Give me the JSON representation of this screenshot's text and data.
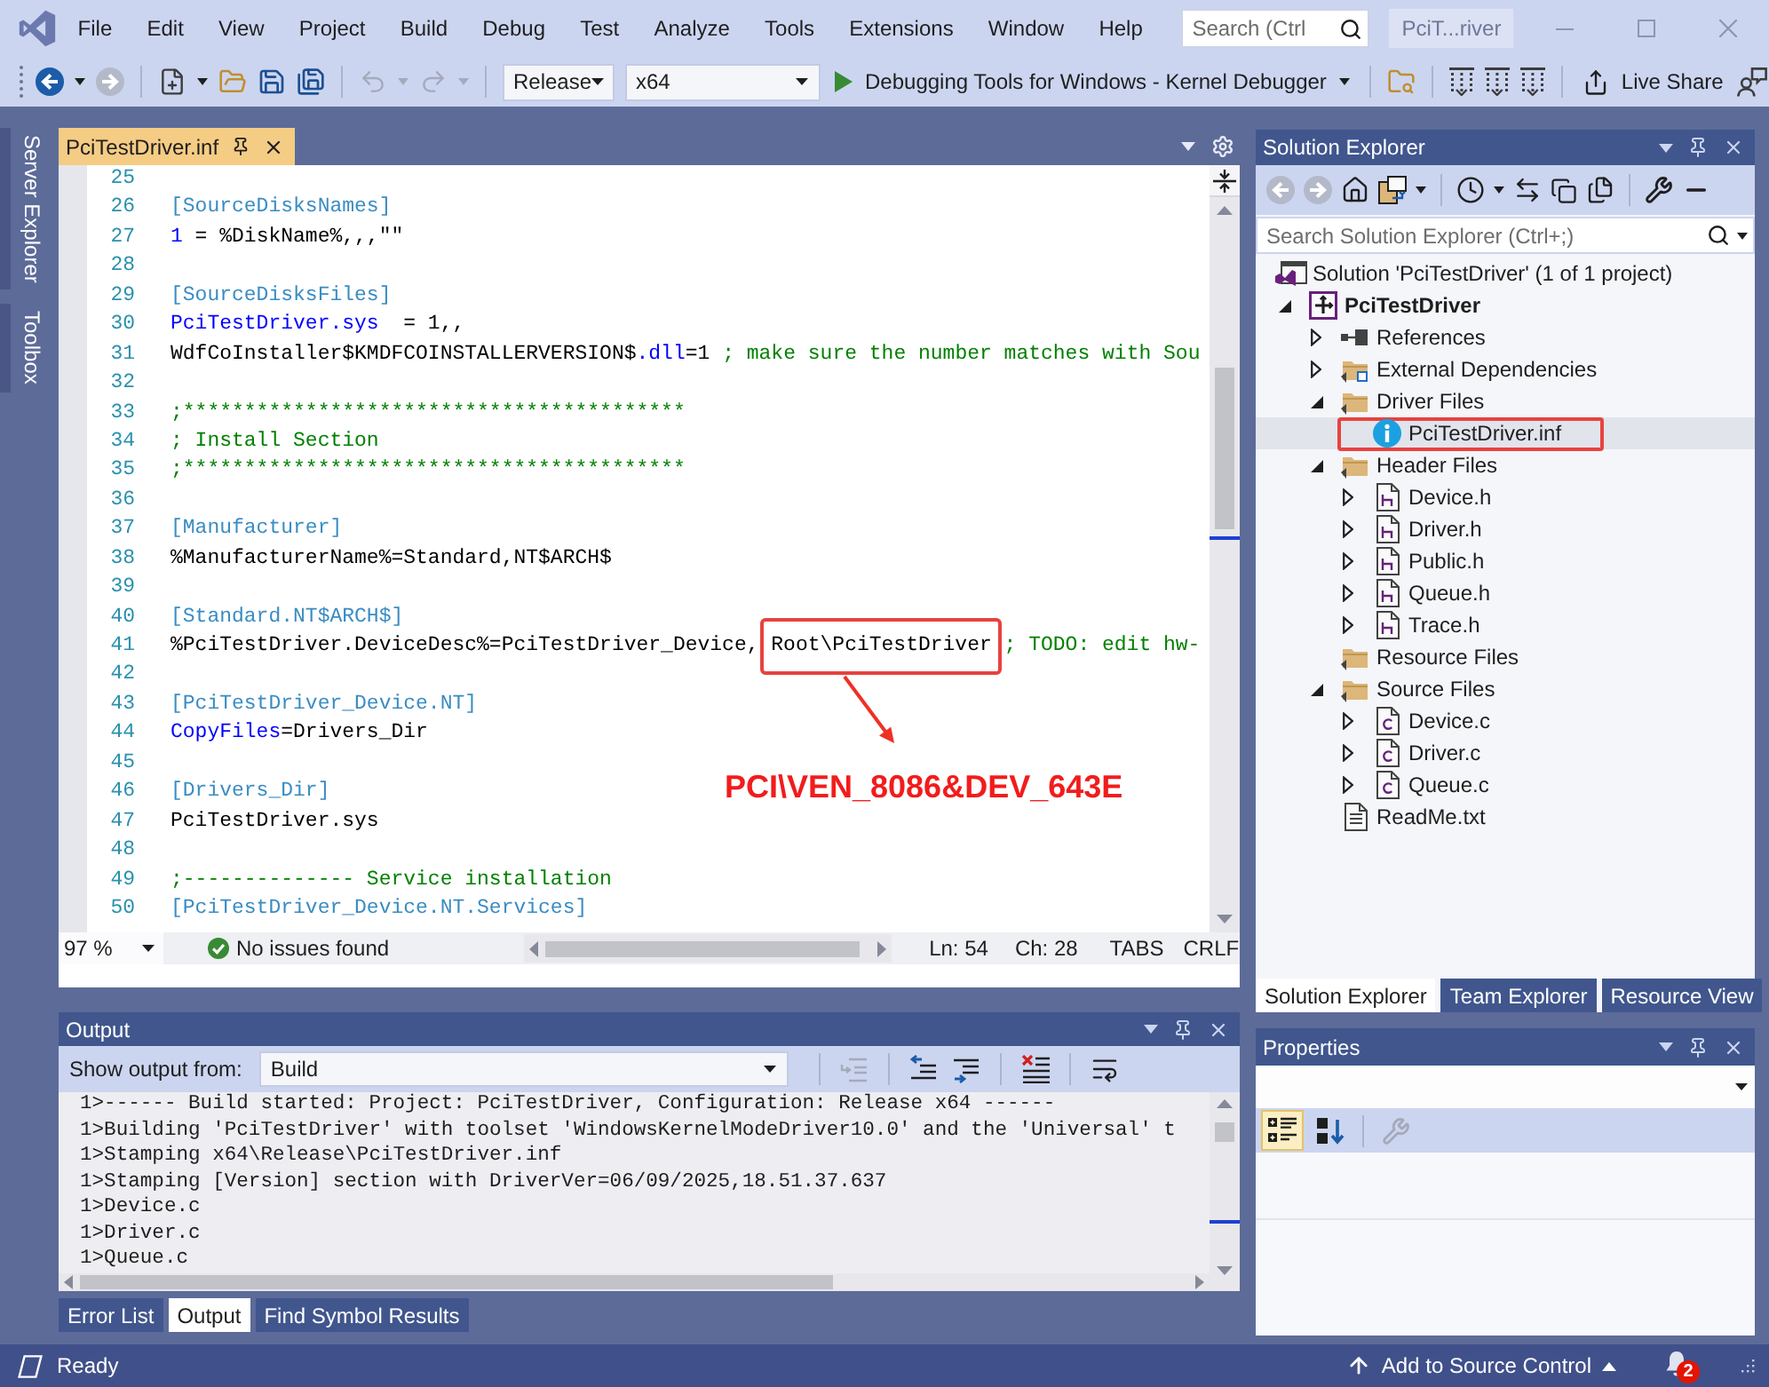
{
  "menu_bar": {
    "items": [
      "File",
      "Edit",
      "View",
      "Project",
      "Build",
      "Debug",
      "Test",
      "Analyze",
      "Tools",
      "Extensions",
      "Window",
      "Help"
    ],
    "search": {
      "placeholder": "Search (Ctrl"
    },
    "window_title": "PciT...river"
  },
  "toolbar": {
    "buttons": [
      {
        "kind": "back",
        "disabled": false
      },
      {
        "kind": "forward",
        "disabled": true
      },
      {
        "kind": "new-project",
        "disabled": false
      },
      {
        "kind": "open",
        "disabled": false
      },
      {
        "kind": "save",
        "disabled": false
      },
      {
        "kind": "save-all",
        "disabled": false
      },
      {
        "kind": "undo",
        "disabled": true
      },
      {
        "kind": "redo",
        "disabled": true
      }
    ],
    "configuration": "Release",
    "platform": "x64",
    "debug_target": "Debugging Tools for Windows - Kernel Debugger",
    "live_share": "Live Share"
  },
  "side_tabs": [
    "Server Explorer",
    "Toolbox"
  ],
  "editor": {
    "tabs": [
      {
        "label": "PciTestDriver.inf",
        "selected": true
      }
    ],
    "lines": [
      {
        "number": "25"
      },
      {
        "number": "26",
        "tokens": [
          {
            "kind": "section",
            "text": "[SourceDisksNames]"
          }
        ]
      },
      {
        "number": "27",
        "tokens": [
          {
            "kind": "keyword",
            "text": "1"
          },
          {
            "kind": "text",
            "text": " = %DiskName%,,,\"\""
          }
        ]
      },
      {
        "number": "28"
      },
      {
        "number": "29",
        "tokens": [
          {
            "kind": "section",
            "text": "[SourceDisksFiles]"
          }
        ]
      },
      {
        "number": "30",
        "tokens": [
          {
            "kind": "keyword",
            "text": "PciTestDriver.sys"
          },
          {
            "kind": "text",
            "text": "  = 1,,"
          }
        ]
      },
      {
        "number": "31",
        "tokens": [
          {
            "kind": "text",
            "text": "WdfCoInstaller$KMDFCOINSTALLERVERSION$"
          },
          {
            "kind": "keyword",
            "text": ".dll"
          },
          {
            "kind": "text",
            "text": "=1 "
          },
          {
            "kind": "comment",
            "text": "; make sure the number matches with Sou"
          }
        ]
      },
      {
        "number": "32"
      },
      {
        "number": "33",
        "tokens": [
          {
            "kind": "comment",
            "text": ";*****************************************"
          }
        ]
      },
      {
        "number": "34",
        "tokens": [
          {
            "kind": "comment",
            "text": "; Install Section"
          }
        ]
      },
      {
        "number": "35",
        "tokens": [
          {
            "kind": "comment",
            "text": ";*****************************************"
          }
        ]
      },
      {
        "number": "36"
      },
      {
        "number": "37",
        "tokens": [
          {
            "kind": "section",
            "text": "[Manufacturer]"
          }
        ]
      },
      {
        "number": "38",
        "tokens": [
          {
            "kind": "text",
            "text": "%ManufacturerName%=Standard,NT$ARCH$"
          }
        ]
      },
      {
        "number": "39"
      },
      {
        "number": "40",
        "tokens": [
          {
            "kind": "section",
            "text": "[Standard.NT$ARCH$]"
          }
        ]
      },
      {
        "number": "41",
        "tokens": [
          {
            "kind": "text",
            "text": "%PciTestDriver.DeviceDesc%=PciTestDriver_Device, "
          },
          {
            "kind": "text",
            "text": "Root\\PciTestDriver",
            "annotated": true
          },
          {
            "kind": "comment",
            "text": " ; TODO: edit hw-"
          }
        ]
      },
      {
        "number": "42"
      },
      {
        "number": "43",
        "tokens": [
          {
            "kind": "section",
            "text": "[PciTestDriver_Device.NT]"
          }
        ]
      },
      {
        "number": "44",
        "tokens": [
          {
            "kind": "keyword",
            "text": "CopyFiles"
          },
          {
            "kind": "text",
            "text": "=Drivers_Dir"
          }
        ]
      },
      {
        "number": "45"
      },
      {
        "number": "46",
        "tokens": [
          {
            "kind": "section",
            "text": "[Drivers_Dir]"
          }
        ]
      },
      {
        "number": "47",
        "tokens": [
          {
            "kind": "text",
            "text": "PciTestDriver.sys"
          }
        ]
      },
      {
        "number": "48"
      },
      {
        "number": "49",
        "tokens": [
          {
            "kind": "comment",
            "text": ";-------------- Service installation"
          }
        ]
      },
      {
        "number": "50",
        "tokens": [
          {
            "kind": "section",
            "text": "[PciTestDriver_Device.NT.Services]"
          }
        ]
      }
    ],
    "annotation": {
      "text": "PCI\\VEN_8086&DEV_643E"
    },
    "status": {
      "zoom": "97 %",
      "issues": "No issues found",
      "line": "Ln: 54",
      "column": "Ch: 28",
      "indent": "TABS",
      "line_ending": "CRLF"
    }
  },
  "output": {
    "title": "Output",
    "source_label": "Show output from:",
    "source": "Build",
    "buttons": [
      {
        "kind": "go-to-location",
        "disabled": true
      },
      {
        "kind": "find-previous",
        "disabled": false
      },
      {
        "kind": "find-next",
        "disabled": false
      },
      {
        "kind": "clear-all",
        "disabled": false
      },
      {
        "kind": "word-wrap",
        "disabled": false
      }
    ],
    "lines": [
      "1>------ Build started: Project: PciTestDriver, Configuration: Release x64 ------",
      "1>Building 'PciTestDriver' with toolset 'WindowsKernelModeDriver10.0' and the 'Universal' t",
      "1>Stamping x64\\Release\\PciTestDriver.inf",
      "1>Stamping [Version] section with DriverVer=06/09/2025,18.51.37.637",
      "1>Device.c",
      "1>Driver.c",
      "1>Queue.c"
    ],
    "tabs": [
      {
        "label": "Error List",
        "selected": false
      },
      {
        "label": "Output",
        "selected": true
      },
      {
        "label": "Find Symbol Results",
        "selected": false
      }
    ]
  },
  "solution_explorer": {
    "title": "Solution Explorer",
    "buttons": [
      {
        "kind": "back",
        "disabled": true
      },
      {
        "kind": "forward",
        "disabled": true
      },
      {
        "kind": "home",
        "disabled": false
      },
      {
        "kind": "switch-views",
        "disabled": false
      },
      {
        "kind": "pending-changes",
        "disabled": false
      },
      {
        "kind": "sync",
        "disabled": false
      },
      {
        "kind": "collapse-all",
        "disabled": false
      },
      {
        "kind": "show-all-files",
        "disabled": false
      },
      {
        "kind": "properties",
        "disabled": false
      },
      {
        "kind": "preview",
        "disabled": false
      }
    ],
    "search": {
      "placeholder": "Search Solution Explorer (Ctrl+;)"
    },
    "tree": [
      {
        "kind": "solution",
        "label": "Solution 'PciTestDriver' (1 of 1 project)",
        "selected": false,
        "children": [
          {
            "kind": "project",
            "label": "PciTestDriver",
            "expanded": true,
            "selected": false,
            "children": [
              {
                "kind": "references",
                "label": "References",
                "expanded": false,
                "selected": false
              },
              {
                "kind": "external",
                "label": "External Dependencies",
                "expanded": false,
                "selected": false
              },
              {
                "kind": "folder",
                "label": "Driver Files",
                "expanded": true,
                "selected": false,
                "children": [
                  {
                    "kind": "info",
                    "label": "PciTestDriver.inf",
                    "selected": true,
                    "annotated": true
                  }
                ]
              },
              {
                "kind": "folder",
                "label": "Header Files",
                "expanded": true,
                "selected": false,
                "children": [
                  {
                    "kind": "header",
                    "label": "Device.h",
                    "expanded": false,
                    "selected": false
                  },
                  {
                    "kind": "header",
                    "label": "Driver.h",
                    "expanded": false,
                    "selected": false
                  },
                  {
                    "kind": "header",
                    "label": "Public.h",
                    "expanded": false,
                    "selected": false
                  },
                  {
                    "kind": "header",
                    "label": "Queue.h",
                    "expanded": false,
                    "selected": false
                  },
                  {
                    "kind": "header",
                    "label": "Trace.h",
                    "expanded": false,
                    "selected": false
                  }
                ]
              },
              {
                "kind": "folder",
                "label": "Resource Files",
                "selected": false
              },
              {
                "kind": "folder",
                "label": "Source Files",
                "expanded": true,
                "selected": false,
                "children": [
                  {
                    "kind": "source",
                    "label": "Device.c",
                    "expanded": false,
                    "selected": false
                  },
                  {
                    "kind": "source",
                    "label": "Driver.c",
                    "expanded": false,
                    "selected": false
                  },
                  {
                    "kind": "source",
                    "label": "Queue.c",
                    "expanded": false,
                    "selected": false
                  }
                ]
              },
              {
                "kind": "text",
                "label": "ReadMe.txt",
                "selected": false
              }
            ]
          }
        ]
      }
    ],
    "tabs": [
      {
        "label": "Solution Explorer",
        "selected": true
      },
      {
        "label": "Team Explorer",
        "selected": false
      },
      {
        "label": "Resource View",
        "selected": false
      }
    ]
  },
  "properties": {
    "title": "Properties",
    "buttons": [
      {
        "kind": "categorized",
        "selected": true,
        "disabled": false
      },
      {
        "kind": "alphabetical",
        "selected": false,
        "disabled": false
      },
      {
        "kind": "property-pages",
        "selected": false,
        "disabled": true
      }
    ]
  },
  "status_bar": {
    "text": "Ready",
    "source_control": "Add to Source Control",
    "notifications": "2"
  }
}
